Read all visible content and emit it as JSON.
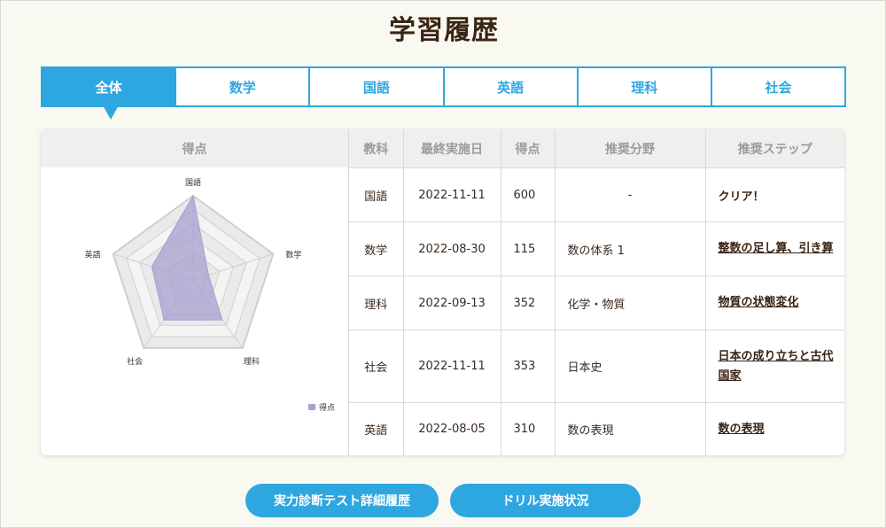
{
  "page": {
    "title": "学習履歴"
  },
  "tabs": [
    {
      "label": "全体",
      "active": true
    },
    {
      "label": "数学",
      "active": false
    },
    {
      "label": "国語",
      "active": false
    },
    {
      "label": "英語",
      "active": false
    },
    {
      "label": "理科",
      "active": false
    },
    {
      "label": "社会",
      "active": false
    }
  ],
  "score_panel": {
    "header": "得点"
  },
  "chart_data": {
    "type": "radar",
    "axes": [
      "国語",
      "数学",
      "理科",
      "社会",
      "英語"
    ],
    "series": [
      {
        "name": "得点",
        "values": [
          600,
          115,
          352,
          353,
          310
        ]
      }
    ],
    "rlim": [
      0,
      600
    ],
    "grid": true,
    "legend": "bottom-right",
    "series_color": "#a79fd0"
  },
  "table": {
    "columns": [
      "教科",
      "最終実施日",
      "得点",
      "推奨分野",
      "推奨ステップ"
    ],
    "rows": [
      {
        "subject": "国語",
        "date": "2022-11-11",
        "score": "600",
        "field": "-",
        "step": "クリア！",
        "step_link": false
      },
      {
        "subject": "数学",
        "date": "2022-08-30",
        "score": "115",
        "field": "数の体系 1",
        "step": "整数の足し算、引き算",
        "step_link": true
      },
      {
        "subject": "理科",
        "date": "2022-09-13",
        "score": "352",
        "field": "化学・物質",
        "step": "物質の状態変化",
        "step_link": true
      },
      {
        "subject": "社会",
        "date": "2022-11-11",
        "score": "353",
        "field": "日本史",
        "step": "日本の成り立ちと古代国家",
        "step_link": true
      },
      {
        "subject": "英語",
        "date": "2022-08-05",
        "score": "310",
        "field": "数の表現",
        "step": "数の表現",
        "step_link": true
      }
    ]
  },
  "buttons": {
    "detail_history": "実力診断テスト詳細履歴",
    "drill_status": "ドリル実施状況"
  },
  "colors": {
    "accent": "#2ea7e0",
    "title": "#3a2414",
    "background": "#faf9f1"
  }
}
